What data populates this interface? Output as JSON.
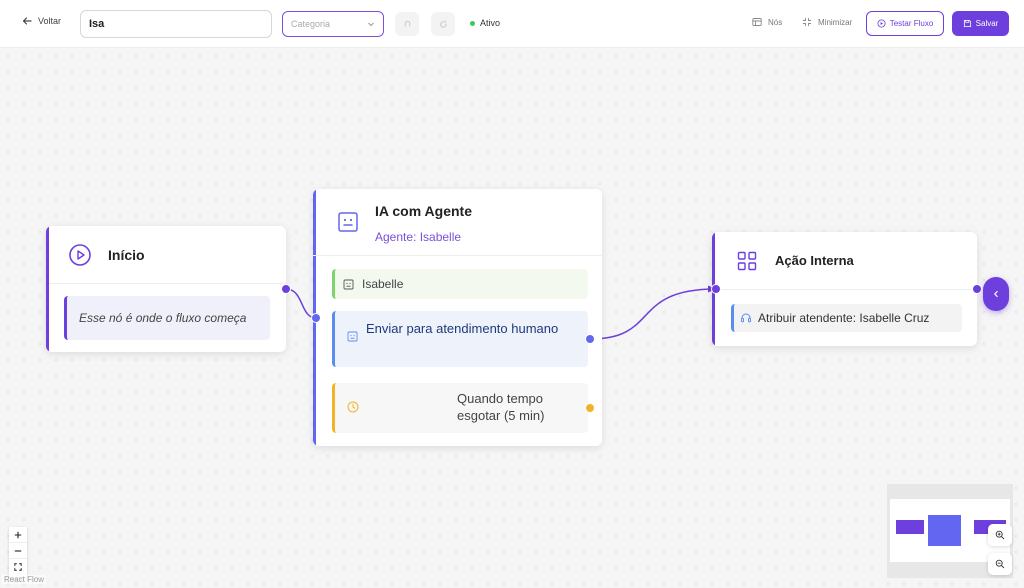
{
  "toolbar": {
    "back_label": "Voltar",
    "flow_name_value": "Isa",
    "category_placeholder": "Categoria",
    "status_label": "Ativo",
    "nodes_label": "Nós",
    "minimize_label": "Minimizar",
    "test_label": "Testar Fluxo",
    "save_label": "Salvar"
  },
  "nodes": {
    "inicio": {
      "title": "Início",
      "description": "Esse nó é onde o fluxo começa",
      "icon": "play-circle-icon"
    },
    "ia_agent": {
      "title": "IA com Agente",
      "subtitle": "Agente: Isabelle",
      "icon": "robot-icon",
      "agent_row": "Isabelle",
      "human_row": "Enviar para atendimento humano",
      "timeout_row": "Quando tempo esgotar (5 min)"
    },
    "acao_interna": {
      "title": "Ação Interna",
      "icon": "grid-icon",
      "action_row": "Atribuir atendente: Isabelle Cruz"
    }
  },
  "canvas": {
    "attribution": "React Flow"
  },
  "colors": {
    "brand": "#6d3fdc",
    "indigo": "#6366f1",
    "status_active": "#3cc85a",
    "agent_green": "#7ed36a",
    "human_blue": "#5b8def",
    "timeout_amber": "#f0b429"
  }
}
